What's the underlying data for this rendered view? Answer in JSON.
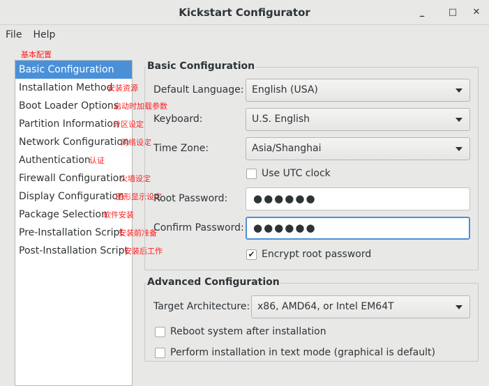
{
  "window": {
    "title": "Kickstart Configurator",
    "minimize": "_",
    "maximize": "□",
    "close": "✕"
  },
  "menu": [
    "File",
    "Help"
  ],
  "annotations": {
    "top": "基本配置",
    "items": [
      "",
      "安装资源",
      "启动时加载参数",
      "分区设定",
      "网络设定",
      "认证",
      "火墙设定",
      "图形显示设定",
      "软件安装",
      "安装前准备",
      "安装后工作"
    ]
  },
  "sidebar": {
    "items": [
      "Basic Configuration",
      "Installation Method",
      "Boot Loader Options",
      "Partition Information",
      "Network Configuration",
      "Authentication",
      "Firewall Configuration",
      "Display Configuration",
      "Package Selection",
      "Pre-Installation Script",
      "Post-Installation Script"
    ],
    "selected": 0
  },
  "basic": {
    "title": "Basic Configuration",
    "language_label": "Default Language:",
    "language": "English (USA)",
    "keyboard_label": "Keyboard:",
    "keyboard": "U.S. English",
    "timezone_label": "Time Zone:",
    "timezone": "Asia/Shanghai",
    "utc_label": "Use UTC clock",
    "utc_checked": false,
    "root_label": "Root Password:",
    "root_value": "●●●●●●",
    "confirm_label": "Confirm Password:",
    "confirm_value": "●●●●●●",
    "encrypt_label": "Encrypt root password",
    "encrypt_checked": true
  },
  "advanced": {
    "title": "Advanced Configuration",
    "arch_label": "Target Architecture:",
    "arch": "x86, AMD64, or Intel EM64T",
    "reboot_label": "Reboot system after installation",
    "reboot_checked": false,
    "text_label": "Perform installation in text mode (graphical is default)",
    "text_checked": false
  },
  "colors": {
    "accent": "#4a90d9",
    "annotation": "#ff2020"
  }
}
